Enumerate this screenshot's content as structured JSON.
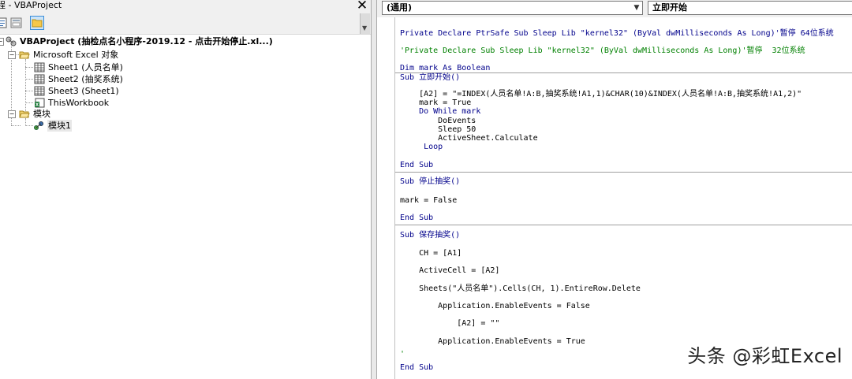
{
  "window": {
    "title": "程 - VBAProject"
  },
  "explorer": {
    "root_label": "VBAProject (抽检点名小程序-2019.12 - 点击开始停止.xl...)",
    "folder_excel": "Microsoft Excel 对象",
    "sheets": [
      "Sheet1 (人员名单)",
      "Sheet2 (抽奖系统)",
      "Sheet3 (Sheet1)",
      "ThisWorkbook"
    ],
    "folder_modules": "模块",
    "module": "模块1"
  },
  "code_window": {
    "object_combo": "(通用)",
    "proc_combo": "立即开始"
  },
  "code": {
    "l1": "Private Declare PtrSafe Sub Sleep Lib \"kernel32\" (ByVal dwMilliseconds As Long)'暂停 64位系统",
    "l2": "'Private Declare Sub Sleep Lib \"kernel32\" (ByVal dwMilliseconds As Long)'暂停  32位系统",
    "l3": "Dim mark As Boolean",
    "l4": "Sub 立即开始()",
    "l5": "    [A2] = \"=INDEX(人员名单!A:B,抽奖系统!A1,1)&CHAR(10)&INDEX(人员名单!A:B,抽奖系统!A1,2)\"",
    "l6": "    mark = True",
    "l7": "    Do While mark",
    "l8": "        DoEvents",
    "l9": "        Sleep 50",
    "l10": "        ActiveSheet.Calculate",
    "l11": "     Loop",
    "l12": "End Sub",
    "l13": "Sub 停止抽奖()",
    "l14": "mark = False",
    "l15": "End Sub",
    "l16": "Sub 保存抽奖()",
    "l17": "    CH = [A1]",
    "l18": "    ActiveCell = [A2]",
    "l19": "    Sheets(\"人员名单\").Cells(CH, 1).EntireRow.Delete",
    "l20": "        Application.EnableEvents = False",
    "l21": "            [A2] = \"\"",
    "l22": "        Application.EnableEvents = True",
    "l23": "'",
    "l24": "End Sub"
  },
  "watermark": "头条 @彩虹Excel"
}
